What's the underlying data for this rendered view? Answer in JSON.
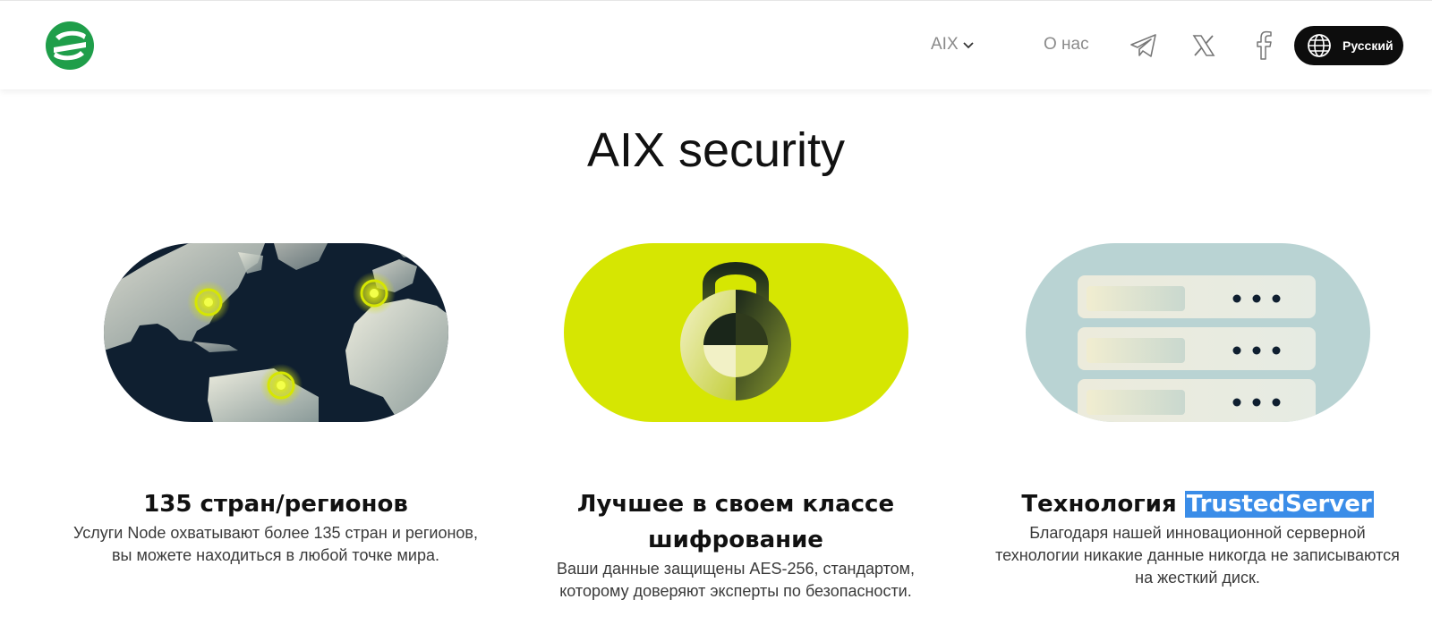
{
  "header": {
    "nav": {
      "aix_label": "AIX",
      "about_label": "О нас"
    },
    "language_button": {
      "label": "Русский",
      "icon": "globe-icon"
    },
    "social_icons": [
      "telegram-icon",
      "x-icon",
      "facebook-icon"
    ]
  },
  "page": {
    "title": "AIX security"
  },
  "features": [
    {
      "title": "135 стран/регионов",
      "description": "Услуги Node охватывают более 135 стран и регионов, вы можете находиться в любой точке мира."
    },
    {
      "title": "Лучшее в своем классе шифрование",
      "description": "Ваши данные защищены AES-256, стандартом, которому доверяют эксперты по безопасности."
    },
    {
      "title_prefix": "Технология ",
      "title_highlight": "TrustedServer",
      "description": "Благодаря нашей инновационной серверной технологии никакие данные никогда не записываются на жесткий диск."
    }
  ],
  "colors": {
    "brand_green": "#1f9e4a",
    "lime": "#d6e602",
    "navy": "#0f1f30",
    "pale_teal": "#b9d3d3",
    "selection": "#3b8de8"
  }
}
